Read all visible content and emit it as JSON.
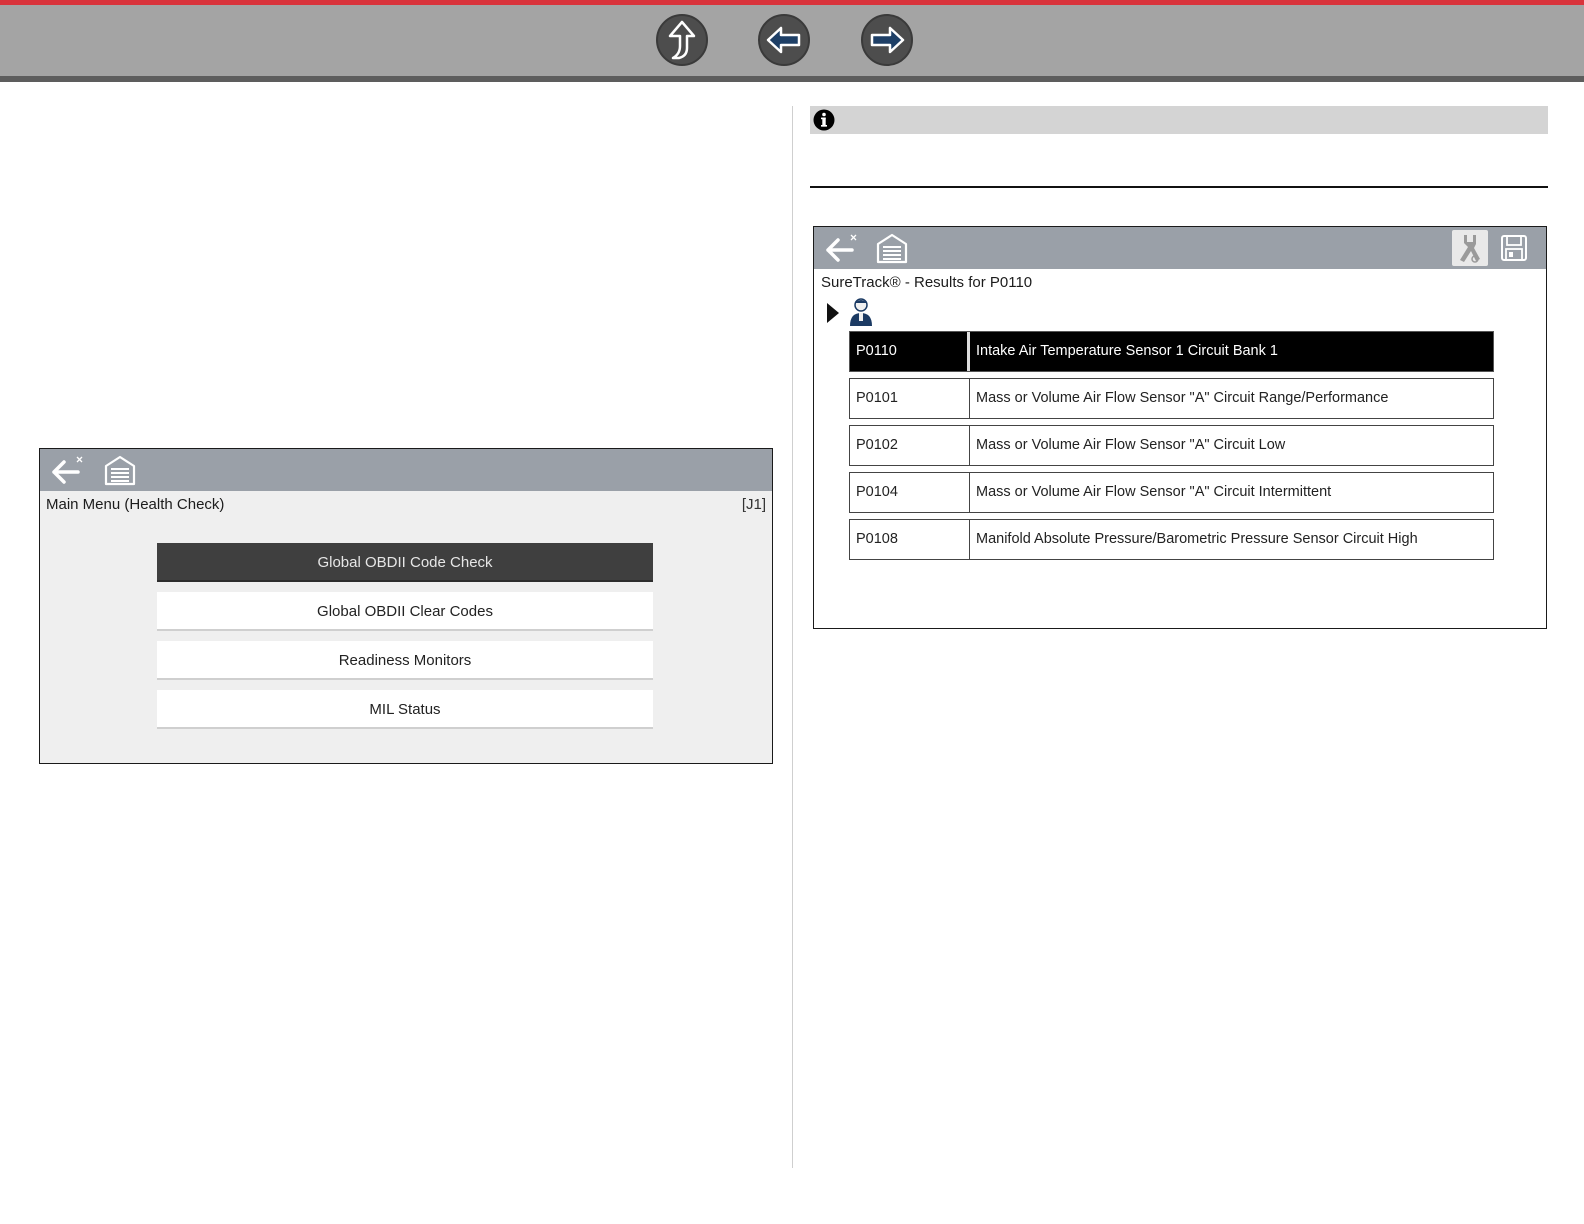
{
  "colors": {
    "accent_red": "#d9333b",
    "nav_bar": "#a4a4a4",
    "screen_toolbar": "#9aa0a8",
    "selected_bg": "#3f3f3f"
  },
  "nav": {
    "buttons": [
      {
        "name": "up-arrow-icon"
      },
      {
        "name": "back-arrow-icon"
      },
      {
        "name": "forward-arrow-icon"
      }
    ]
  },
  "info_bar": {
    "icon": "info-icon"
  },
  "health_check_screen": {
    "toolbar_icons": [
      "back-icon",
      "home-icon"
    ],
    "title": "Main Menu (Health Check)",
    "screen_id": "[J1]",
    "menu_items": [
      {
        "label": "Global OBDII Code Check",
        "selected": true
      },
      {
        "label": "Global OBDII Clear Codes",
        "selected": false
      },
      {
        "label": "Readiness Monitors",
        "selected": false
      },
      {
        "label": "MIL Status",
        "selected": false
      }
    ]
  },
  "suretrack_screen": {
    "toolbar_icons": [
      "back-icon",
      "home-icon",
      "tools-icon",
      "save-icon"
    ],
    "title": "SureTrack® - Results for P0110",
    "codes": [
      {
        "code": "P0110",
        "description": "Intake Air Temperature Sensor 1 Circuit Bank 1",
        "selected": true
      },
      {
        "code": "P0101",
        "description": "Mass or Volume Air Flow Sensor \"A\" Circuit Range/Performance",
        "selected": false
      },
      {
        "code": "P0102",
        "description": "Mass or Volume Air Flow Sensor \"A\" Circuit Low",
        "selected": false
      },
      {
        "code": "P0104",
        "description": "Mass or Volume Air Flow Sensor \"A\" Circuit Intermittent",
        "selected": false
      },
      {
        "code": "P0108",
        "description": "Manifold Absolute Pressure/Barometric Pressure Sensor Circuit High",
        "selected": false
      }
    ]
  }
}
